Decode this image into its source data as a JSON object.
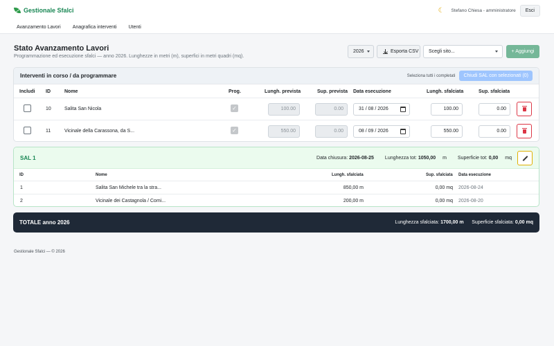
{
  "brand": {
    "name": "Gestionale Sfalci",
    "icon": "leaf-icon",
    "color": "#198754"
  },
  "header": {
    "user": "Stefano Chiesa - amministratore",
    "logout": "Esci",
    "theme_icon": "moon-icon"
  },
  "nav": [
    "Avanzamento Lavori",
    "Anagrafica interventi",
    "Utenti"
  ],
  "page": {
    "title": "Stato Avanzamento Lavori",
    "subtitle": "Programmazione ed esecuzione sfalci — anno 2026. Lunghezze in metri (m), superfici in metri quadri (mq)."
  },
  "toolbar": {
    "year": "2026",
    "export": "Esporta CSV",
    "site_placeholder": "Scegli sito...",
    "add": "+ Aggiungi",
    "add_color": "#75b798"
  },
  "interventi": {
    "title": "Interventi in corso / da programmare",
    "select_all": "Seleziona tutti i completati",
    "close_button": "Chiudi SAL con selezionati (0)",
    "columns": {
      "include": "Includi",
      "id": "ID",
      "name": "Nome",
      "prog": "Prog.",
      "len_plan": "Lungh. prevista",
      "sup_plan": "Sup. prevista",
      "date": "Data esecuzione",
      "len_done": "Lungh. sfalciata",
      "sup_done": "Sup. sfalciata"
    },
    "rows": [
      {
        "id": "10",
        "name": "Salita San Nicola",
        "len_plan": "100.00",
        "sup_plan": "0.00",
        "date": "31 / 08 / 2026",
        "len_done": "100.00",
        "sup_done": "0.00"
      },
      {
        "id": "11",
        "name": "Vicinale della Carassona, da S...",
        "len_plan": "550.00",
        "sup_plan": "0.00",
        "date": "08 / 09 / 2026",
        "len_done": "550.00",
        "sup_done": "0.00"
      }
    ]
  },
  "sal": {
    "title": "SAL 1",
    "closing_label": "Data chiusura:",
    "closing_value": "2026-08-25",
    "len_label": "Lunghezza tot:",
    "len_value": "1050,00",
    "len_unit": "m",
    "sup_label": "Superficie tot:",
    "sup_value": "0,00",
    "sup_unit": "mq",
    "columns": {
      "id": "ID",
      "name": "Nome",
      "len": "Lungh. sfalciata",
      "sup": "Sup. sfalciata",
      "date": "Data esecuzione"
    },
    "rows": [
      {
        "id": "1",
        "name": "Salita San Michele tra la stra...",
        "len": "850,00 m",
        "sup": "0,00 mq",
        "date": "2026-08-24"
      },
      {
        "id": "2",
        "name": "Vicinale dei Castagnola / Comi...",
        "len": "200,00 m",
        "sup": "0,00 mq",
        "date": "2026-08-20"
      }
    ]
  },
  "total": {
    "label": "TOTALE anno 2026",
    "len_label": "Lunghezza sfalciata:",
    "len_value": "1700,00 m",
    "sup_label": "Superficie sfalciata:",
    "sup_value": "0,00 mq"
  },
  "footer": "Gestionale Sfalci — © 2026"
}
